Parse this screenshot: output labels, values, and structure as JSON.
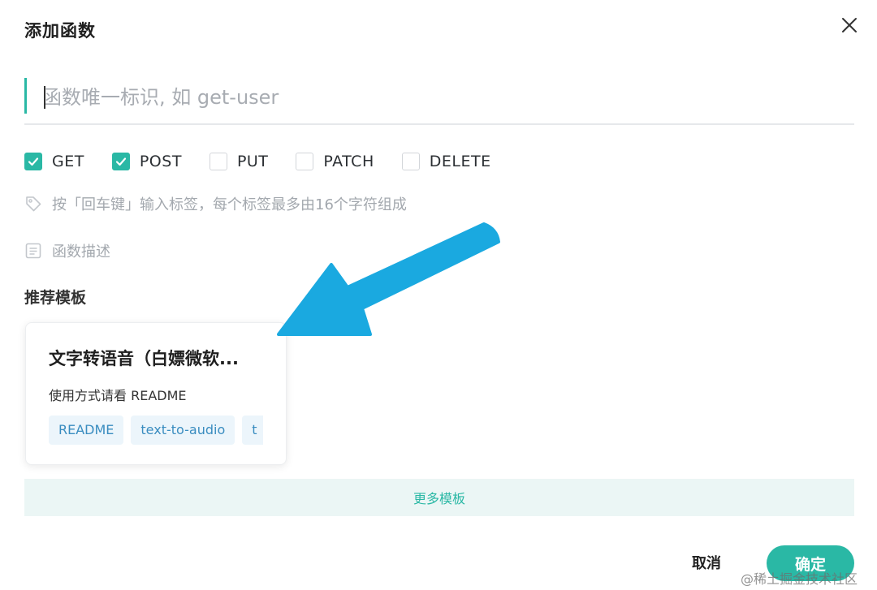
{
  "dialog": {
    "title": "添加函数",
    "close_icon": "close-icon"
  },
  "name_field": {
    "placeholder": "函数唯一标识, 如 get-user",
    "value": ""
  },
  "methods": [
    {
      "label": "GET",
      "checked": true
    },
    {
      "label": "POST",
      "checked": true
    },
    {
      "label": "PUT",
      "checked": false
    },
    {
      "label": "PATCH",
      "checked": false
    },
    {
      "label": "DELETE",
      "checked": false
    }
  ],
  "tags_field": {
    "icon": "tag-icon",
    "placeholder": "按「回车键」输入标签，每个标签最多由16个字符组成"
  },
  "description_field": {
    "icon": "document-icon",
    "placeholder": "函数描述"
  },
  "templates": {
    "section_title": "推荐模板",
    "cards": [
      {
        "title": "文字转语音（白嫖微软...",
        "description": "使用方式请看 README",
        "tags": [
          "README",
          "text-to-audio",
          "t"
        ]
      }
    ],
    "more_label": "更多模板"
  },
  "footer": {
    "cancel_label": "取消",
    "confirm_label": "确定"
  },
  "watermark": "@稀土掘金技术社区",
  "colors": {
    "accent": "#2ab8a5",
    "arrow": "#1aa9e0",
    "tag_bg": "#ecf5fb",
    "tag_text": "#3a8dc0"
  }
}
